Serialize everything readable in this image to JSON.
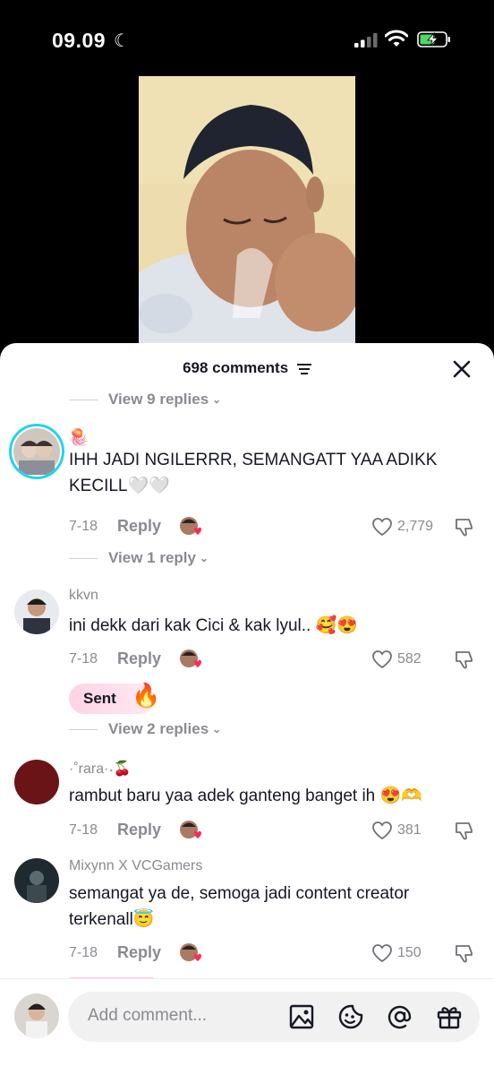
{
  "status_bar": {
    "time": "09.09"
  },
  "sheet": {
    "comment_count": "698 comments",
    "top_replies": "View 9 replies"
  },
  "comments": [
    {
      "username": "",
      "username_emoji": "🪼",
      "text": "IHH JADI NGILERRR, SEMANGATT YAA ADIKK KECILL🤍🤍",
      "date": "7-18",
      "reply_label": "Reply",
      "likes": "2,779",
      "view_replies": "View 1 reply"
    },
    {
      "username": "kkvn",
      "text": "ini dekk dari kak Cici & kak lyul.. 🥰😍",
      "date": "7-18",
      "reply_label": "Reply",
      "likes": "582",
      "sent_badge": "Sent",
      "view_replies": "View 2 replies"
    },
    {
      "username": "·˚rara·˖🍒",
      "text": "rambut baru yaa adek ganteng banget ih 😍🫶",
      "date": "7-18",
      "reply_label": "Reply",
      "likes": "381"
    },
    {
      "username": "Mixynn X VCGamers",
      "text": "semangat ya de, semoga jadi content creator terkenall😇",
      "date": "7-18",
      "reply_label": "Reply",
      "likes": "150"
    }
  ],
  "composer": {
    "placeholder": "Add comment..."
  },
  "icons": {
    "status": [
      "moon-icon",
      "signal-icon",
      "wifi-icon",
      "battery-charging-icon"
    ],
    "header": [
      "sort-icon",
      "close-icon"
    ],
    "comment_actions": [
      "heart-icon",
      "dislike-icon",
      "creator-liked-badge"
    ],
    "composer": [
      "image-icon",
      "emoji-icon",
      "mention-icon",
      "gift-icon"
    ]
  },
  "colors": {
    "accent_pink": "#fe2c55",
    "text_primary": "#161823",
    "text_secondary": "#8a8b91",
    "avatar_ring": "#20d5ec"
  }
}
